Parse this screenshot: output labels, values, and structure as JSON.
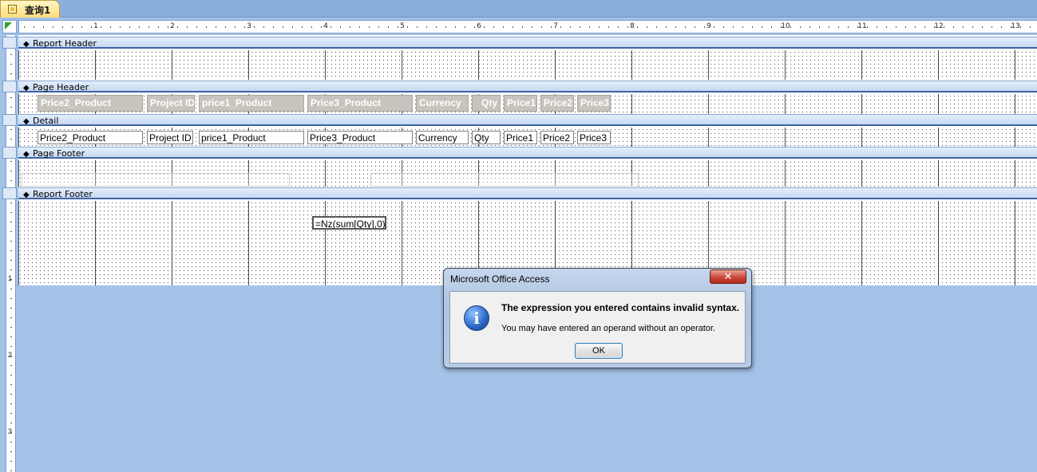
{
  "tab": {
    "label": "查询1",
    "icon": "report-icon"
  },
  "ruler": {
    "horizontal_numbers": [
      "1",
      "2",
      "3",
      "4",
      "5",
      "6",
      "7",
      "8",
      "9",
      "10",
      "11",
      "12",
      "13"
    ],
    "vertical_numbers": [
      "1",
      "2",
      "3"
    ]
  },
  "bands": {
    "report_header": "Report Header",
    "page_header": "Page Header",
    "detail": "Detail",
    "page_footer": "Page Footer",
    "report_footer": "Report Footer"
  },
  "page_header_labels": [
    "Price2_Product",
    "Project ID",
    "price1_Product",
    "Price3_Product",
    "Currency",
    "Qty",
    "Price1",
    "Price2",
    "Price3"
  ],
  "detail_fields": [
    "Price2_Product",
    "Project ID",
    "price1_Product",
    "Price3_Product",
    "Currency",
    "Qty",
    "Price1",
    "Price2",
    "Price3"
  ],
  "report_footer_expression": "=Nz(sum[Qty],0)",
  "dialog": {
    "title": "Microsoft Office Access",
    "close_glyph": "✕",
    "icon": "info-icon",
    "icon_glyph": "i",
    "message": "The expression you entered contains invalid syntax.",
    "detail": "You may have entered an operand without an operator.",
    "ok_label": "OK"
  },
  "colors": {
    "workspace": "#a4c2e8",
    "label_fill": "#c7c4bd",
    "band_border": "#3f62a3",
    "close_red": "#c9473a"
  }
}
